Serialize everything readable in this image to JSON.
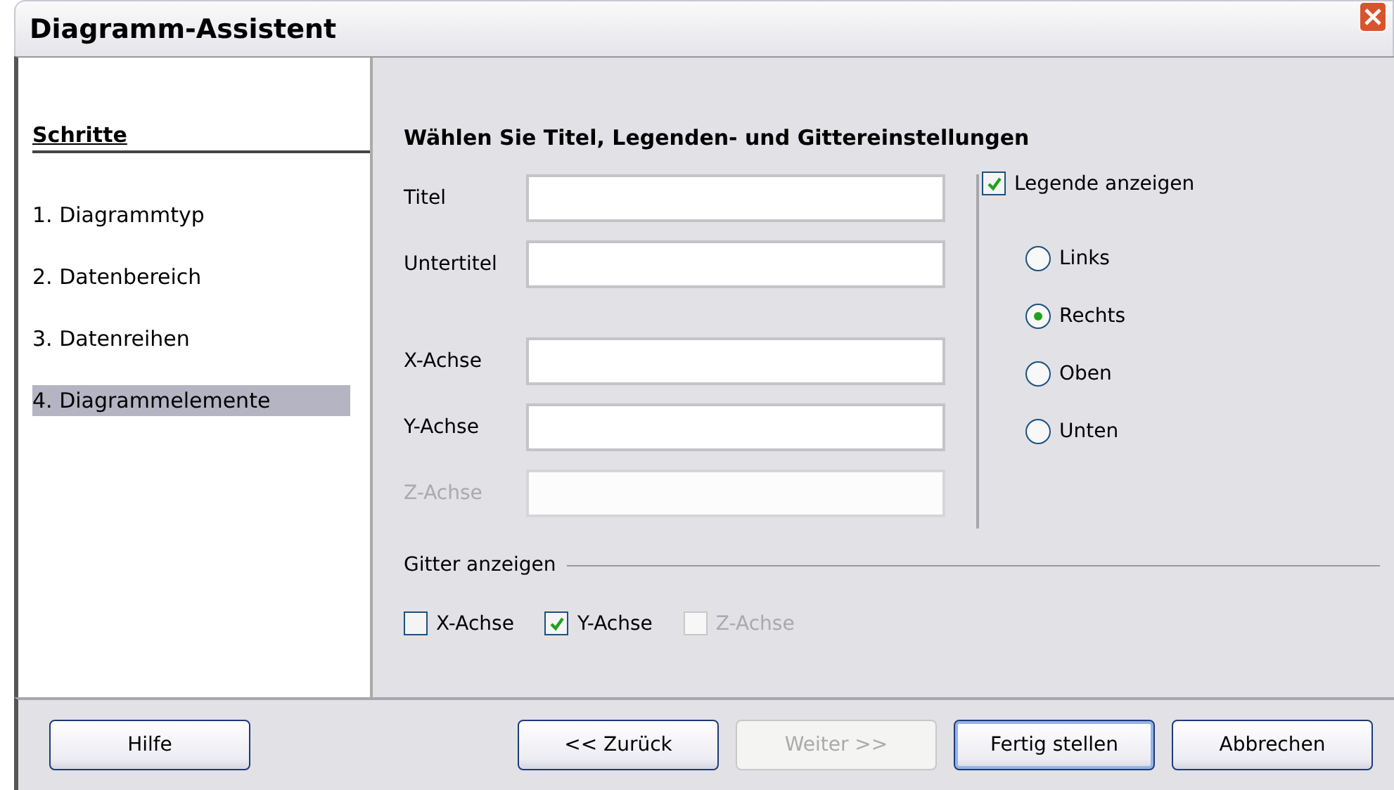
{
  "window": {
    "title": "Diagramm-Assistent"
  },
  "steps": {
    "heading": "Schritte",
    "items": [
      {
        "label": "1. Diagrammtyp",
        "selected": false
      },
      {
        "label": "2. Datenbereich",
        "selected": false
      },
      {
        "label": "3. Datenreihen",
        "selected": false
      },
      {
        "label": "4. Diagrammelemente",
        "selected": true
      }
    ]
  },
  "page": {
    "heading": "Wählen Sie Titel, Legenden- und Gittereinstellungen",
    "title_fields": [
      {
        "label": "Titel",
        "disabled": false
      },
      {
        "label": "Untertitel",
        "disabled": false
      }
    ],
    "axis_fields": [
      {
        "label": "X-Achse",
        "disabled": false
      },
      {
        "label": "Y-Achse",
        "disabled": false
      },
      {
        "label": "Z-Achse",
        "disabled": true
      }
    ],
    "legend": {
      "label": "Legende anzeigen",
      "checked": true,
      "positions": [
        {
          "label": "Links",
          "selected": false
        },
        {
          "label": "Rechts",
          "selected": true
        },
        {
          "label": "Oben",
          "selected": false
        },
        {
          "label": "Unten",
          "selected": false
        }
      ]
    },
    "grid": {
      "label": "Gitter anzeigen",
      "axes": [
        {
          "label": "X-Achse",
          "checked": false,
          "disabled": false
        },
        {
          "label": "Y-Achse",
          "checked": true,
          "disabled": false
        },
        {
          "label": "Z-Achse",
          "checked": false,
          "disabled": true
        }
      ]
    }
  },
  "buttons": [
    {
      "label": "Hilfe",
      "disabled": false,
      "default": false
    },
    {
      "label": "<< Zurück",
      "disabled": false,
      "default": false
    },
    {
      "label": "Weiter >>",
      "disabled": true,
      "default": false
    },
    {
      "label": "Fertig stellen",
      "disabled": false,
      "default": true
    },
    {
      "label": "Abbrechen",
      "disabled": false,
      "default": false
    }
  ]
}
